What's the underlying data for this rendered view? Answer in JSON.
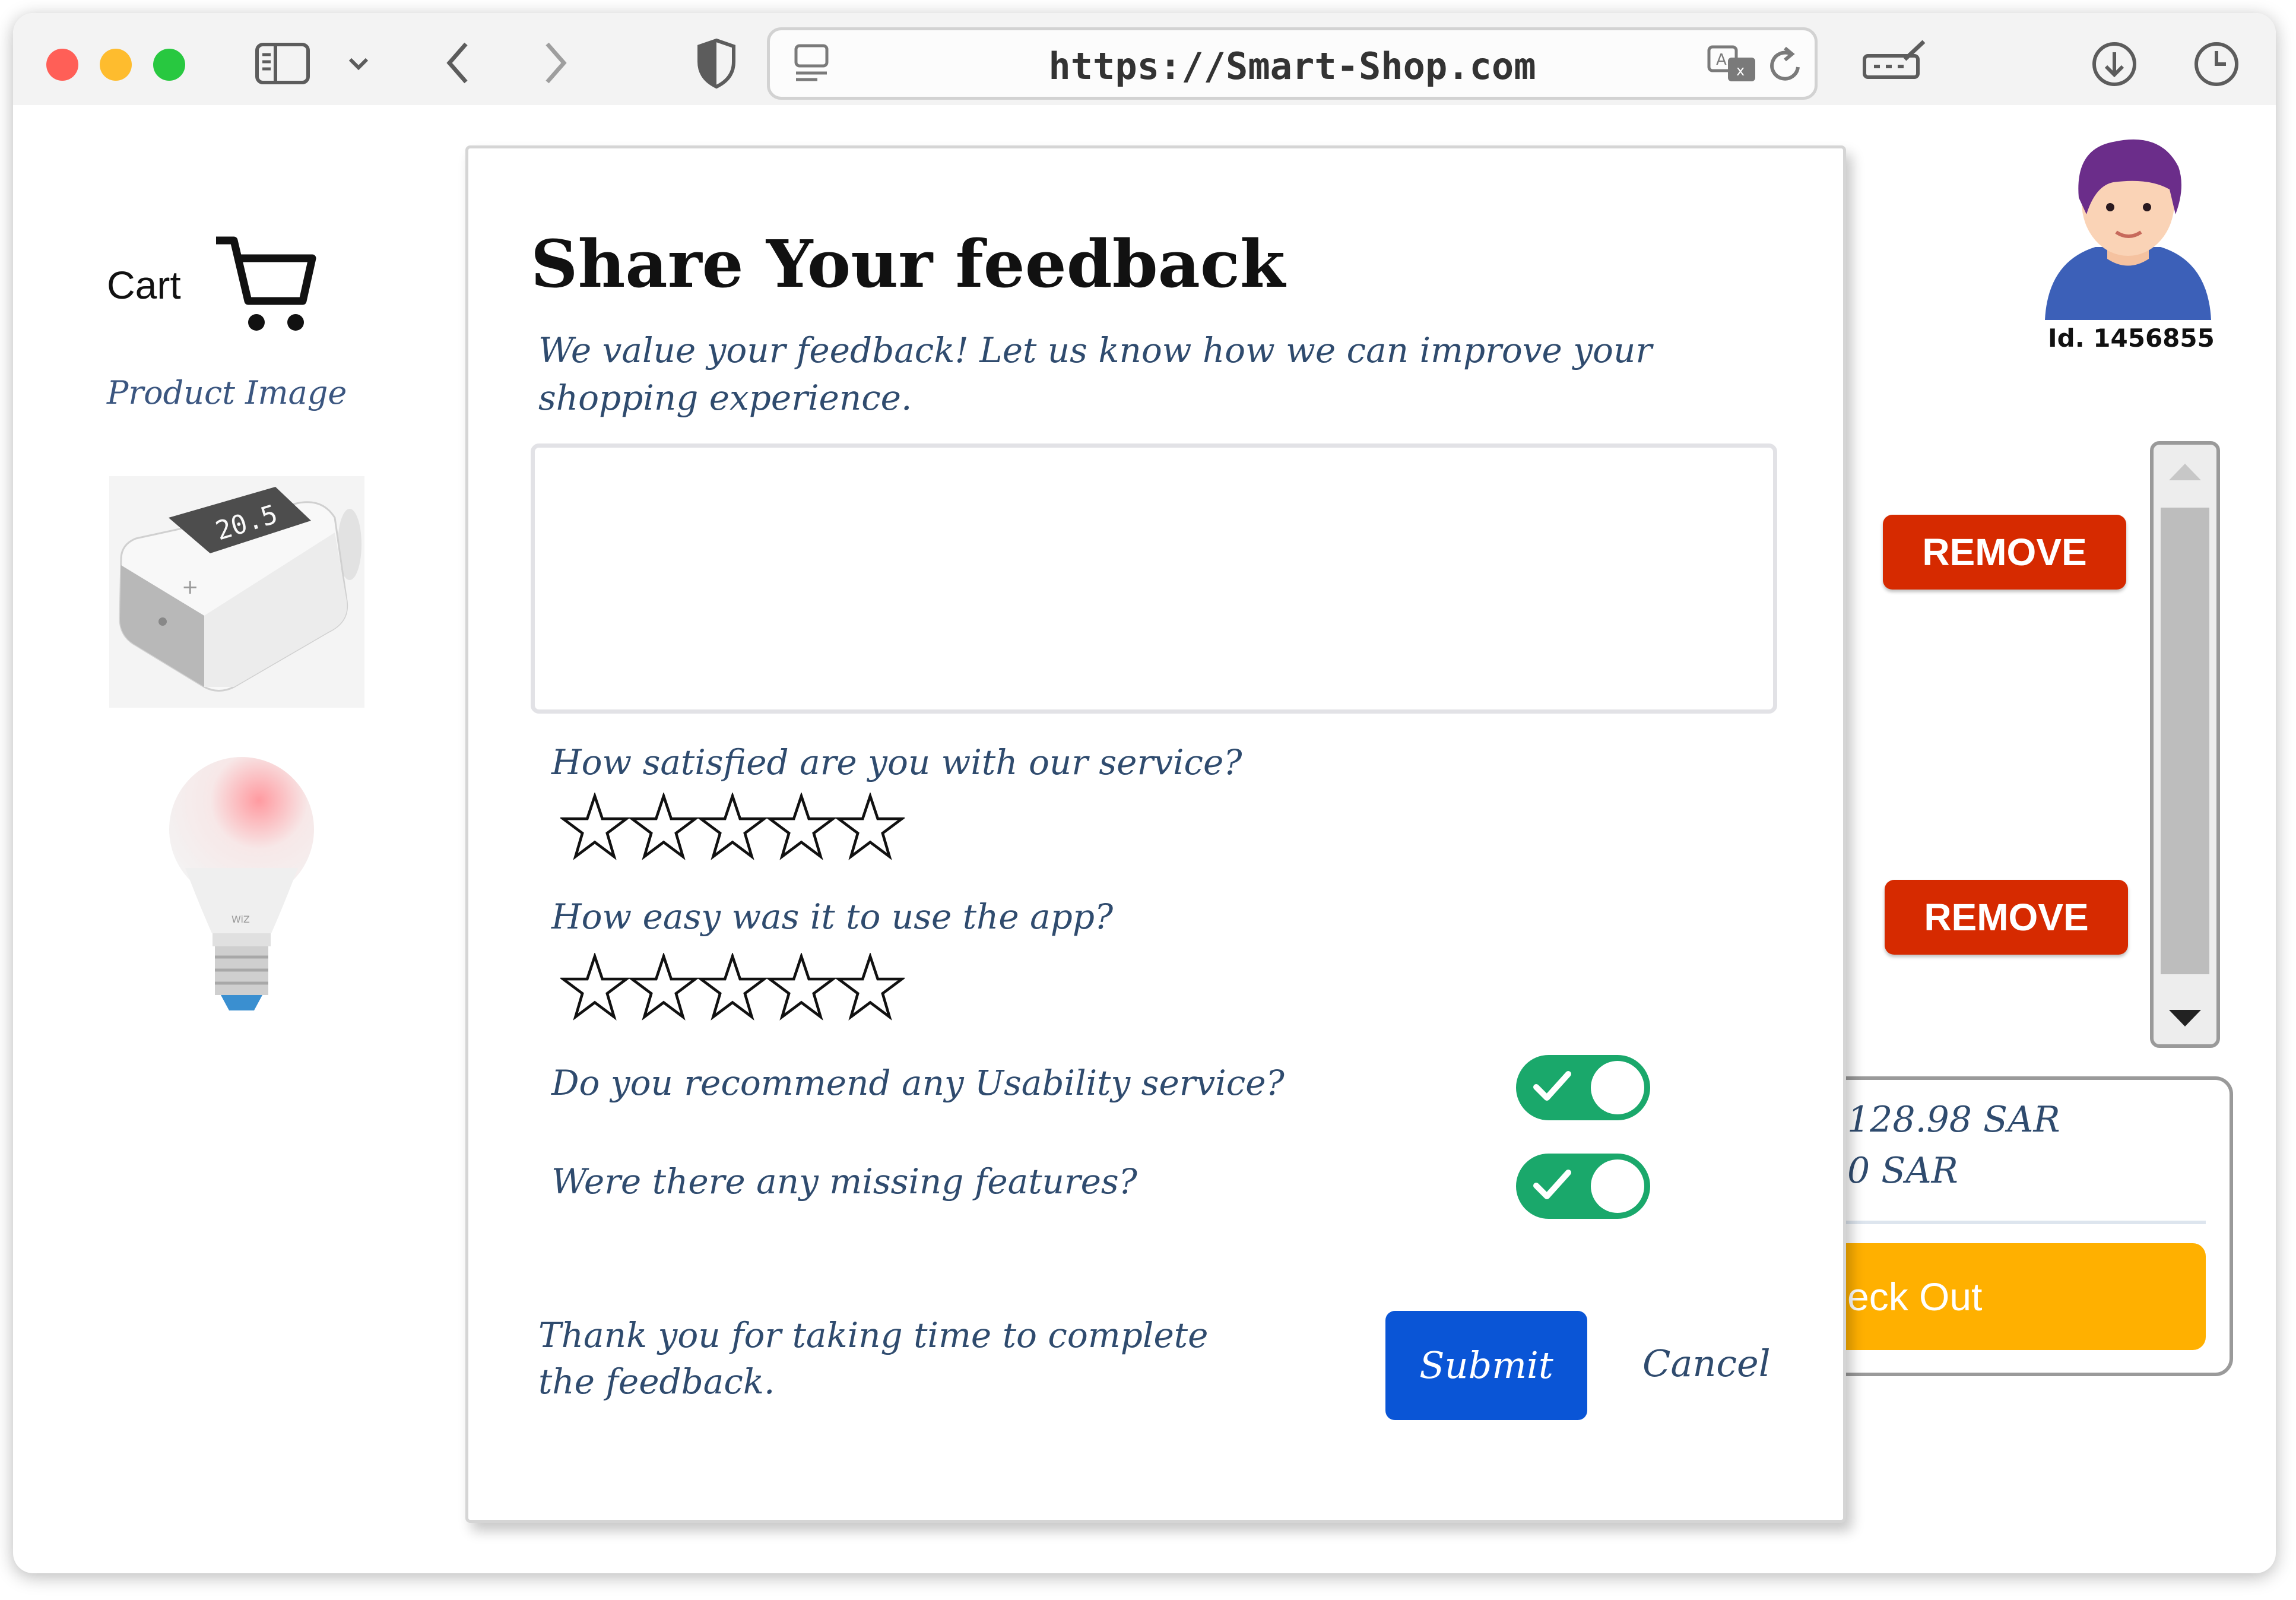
{
  "browser": {
    "url": "https://Smart-Shop.com",
    "traffic_lights": [
      "#ff5f57",
      "#febc2e",
      "#28c840"
    ]
  },
  "cart": {
    "label": "Cart",
    "product_header": "Product Image",
    "products": [
      {
        "name": "smart-thermostat"
      },
      {
        "name": "smart-bulb"
      }
    ],
    "remove_label": "REMOVE"
  },
  "user": {
    "id_label": "Id. 1456855"
  },
  "summary": {
    "line1": "128.98 SAR",
    "line2": "0 SAR",
    "checkout_label": "eck Out"
  },
  "modal": {
    "title": "Share Your feedback",
    "intro": "We value your feedback! Let us know how we can improve your shopping experience.",
    "textarea_value": "",
    "q1": "How satisfied are you with our service?",
    "q1_stars": 0,
    "q2": "How easy was it to use the app?",
    "q2_stars": 0,
    "toggle1_label": "Do you recommend any Usability service?",
    "toggle1_on": true,
    "toggle2_label": "Were there any missing features?",
    "toggle2_on": true,
    "thanks": "Thank you for taking time to complete the feedback.",
    "submit_label": "Submit",
    "cancel_label": "Cancel"
  },
  "colors": {
    "remove": "#d62a00",
    "checkout": "#ffb000",
    "submit": "#0a55d6",
    "toggle_on": "#1aa86b"
  }
}
